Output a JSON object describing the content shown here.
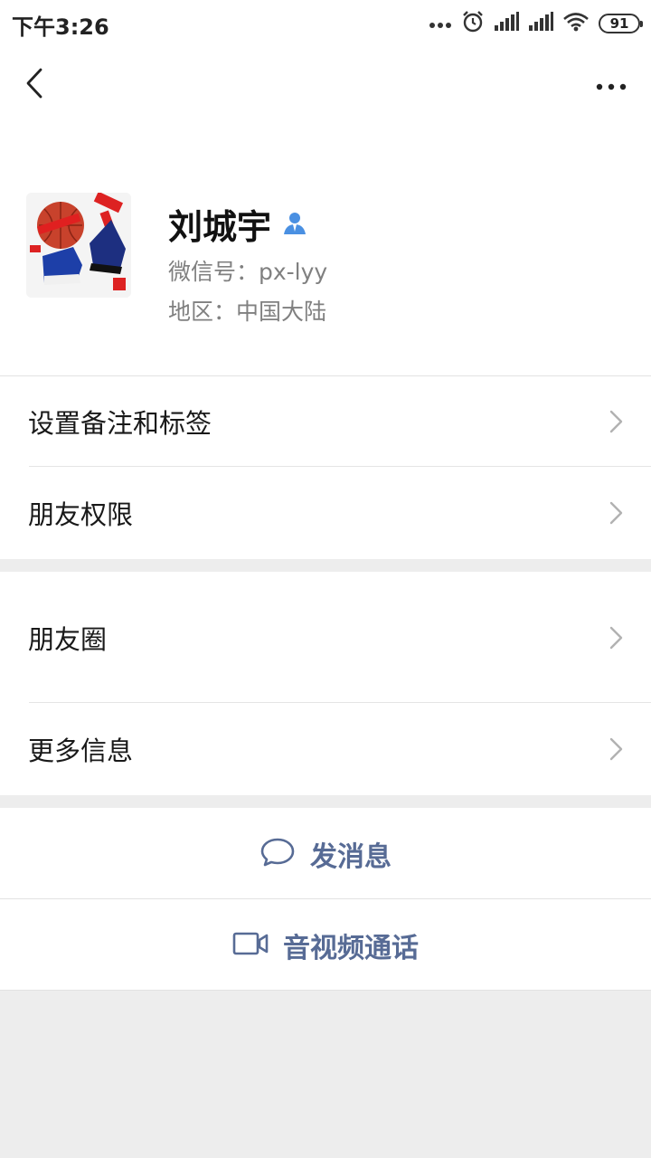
{
  "status_bar": {
    "time": "下午3:26",
    "battery": "91"
  },
  "nav": {
    "back_icon": "chevron-left-icon",
    "more_icon": "more-dots-icon"
  },
  "profile": {
    "name": "刘城宇",
    "wechat_id": "微信号：px-lyy",
    "region": "地区：中国大陆",
    "verified_icon": "person-icon",
    "verified_color": "#4a90e2"
  },
  "settings": {
    "remark_tags": "设置备注和标签",
    "friend_permissions": "朋友权限"
  },
  "content": {
    "moments": "朋友圈",
    "more_info": "更多信息"
  },
  "actions": {
    "send_message": "发消息",
    "video_call": "音视频通话",
    "link_color": "#576b95"
  }
}
